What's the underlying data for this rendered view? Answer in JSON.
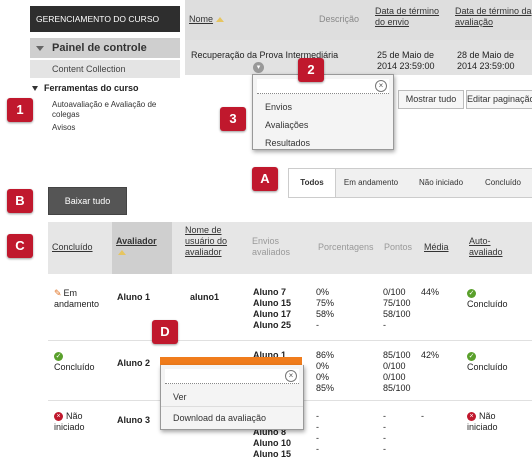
{
  "sidebar": {
    "course_header": "GERENCIAMENTO DO CURSO",
    "control_panel": "Painel de controle",
    "content_collection": "Content Collection",
    "tools_header": "Ferramentas do curso",
    "tool_items": [
      "Autoavaliação e Avaliação de colegas",
      "Avisos"
    ]
  },
  "top_table": {
    "headers": [
      "Nome",
      "Descrição",
      "Data de término do envio",
      "Data de término da avaliação"
    ],
    "row": {
      "name": "Recuperação da Prova Intermediária",
      "submit_end": "25 de Maio de 2014 23:59:00",
      "review_end": "28 de Maio de 2014 23:59:00"
    },
    "buttons": [
      "Mostrar tudo",
      "Editar paginação"
    ]
  },
  "context_menu_1": {
    "items": [
      "Envios",
      "Avaliações",
      "Resultados"
    ]
  },
  "filter_tabs": [
    "Todos",
    "Em andamento",
    "Não iniciado",
    "Concluído"
  ],
  "download_button": "Baixar tudo",
  "main_table": {
    "headers": [
      "Concluído",
      "Avaliador",
      "Nome de usuário do avaliador",
      "Envios avaliados",
      "Porcentagens",
      "Pontos",
      "Média",
      "Auto-avaliado"
    ],
    "rows": [
      {
        "status": "Em andamento",
        "evaluator": "Aluno 1",
        "username": "aluno1",
        "submissions": [
          "Aluno 7",
          "Aluno 15",
          "Aluno 17",
          "Aluno 25"
        ],
        "percentages": [
          "0%",
          "75%",
          "58%",
          "-"
        ],
        "points": [
          "0/100",
          "75/100",
          "58/100",
          "-"
        ],
        "average": "44%",
        "self_evaluated": "Concluído"
      },
      {
        "status": "Concluído",
        "evaluator": "Aluno 2",
        "username": "",
        "submissions": [
          "Aluno 1"
        ],
        "percentages": [
          "86%",
          "0%",
          "0%",
          "85%"
        ],
        "points": [
          "85/100",
          "0/100",
          "0/100",
          "85/100"
        ],
        "average": "42%",
        "self_evaluated": "Concluído"
      },
      {
        "status": "Não iniciado",
        "evaluator": "Aluno 3",
        "username": "",
        "submissions": [
          "Aluno 8",
          "Aluno 10",
          "Aluno 15"
        ],
        "percentages": [
          "-",
          "-",
          "-",
          "-"
        ],
        "points": [
          "-",
          "-",
          "-",
          "-"
        ],
        "average": "-",
        "self_evaluated": "Não iniciado"
      }
    ]
  },
  "context_menu_2": {
    "items": [
      "Ver",
      "Download da avaliação"
    ]
  },
  "badges": [
    "1",
    "2",
    "3",
    "A",
    "B",
    "C",
    "D"
  ],
  "colors": {
    "badge": "#c0182d",
    "orange": "#f07c1c",
    "ok_green": "#5aa02c"
  }
}
